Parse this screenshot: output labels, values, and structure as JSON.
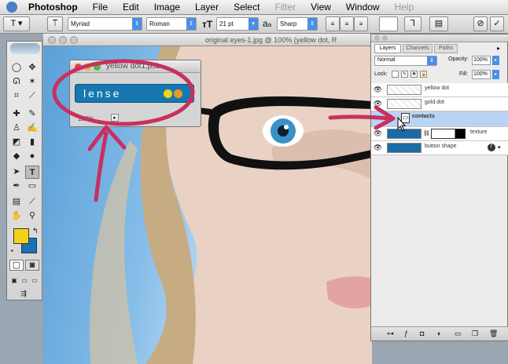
{
  "menubar": {
    "items": [
      {
        "label": "Photoshop",
        "style": "bold"
      },
      {
        "label": "File"
      },
      {
        "label": "Edit"
      },
      {
        "label": "Image"
      },
      {
        "label": "Layer"
      },
      {
        "label": "Select"
      },
      {
        "label": "Filter",
        "style": "dim"
      },
      {
        "label": "View"
      },
      {
        "label": "Window"
      },
      {
        "label": "Help",
        "style": "dim"
      }
    ]
  },
  "options": {
    "font_family": "Myriad",
    "font_style": "Roman",
    "font_size": "21 pt",
    "antialias_icon_label": "a",
    "antialias_icon_label_small": "a",
    "antialias": "Sharp"
  },
  "canvas": {
    "title": "original eyes-1.jpg @ 100% (yellow dot, R"
  },
  "popup": {
    "title": "yellow dot1.psb",
    "text_value": "lense",
    "zoom": "100%"
  },
  "layers_panel": {
    "tabs": [
      "Layers",
      "Channels",
      "Paths"
    ],
    "blend_mode": "Normal",
    "opacity_label": "Opacity:",
    "opacity": "100%",
    "lock_label": "Lock:",
    "fill_label": "Fill:",
    "fill": "100%",
    "layers": [
      {
        "name": "yellow dot",
        "selected": false
      },
      {
        "name": "gold dot",
        "selected": false
      },
      {
        "name": "contacts",
        "selected": true
      },
      {
        "name": "texture",
        "selected": false
      },
      {
        "name": "button shape",
        "selected": false
      }
    ]
  },
  "colors": {
    "foreground": "#f4d21a",
    "background": "#1a72b6",
    "accent_blue": "#1777b0",
    "annotation_pink": "#c8305e"
  }
}
